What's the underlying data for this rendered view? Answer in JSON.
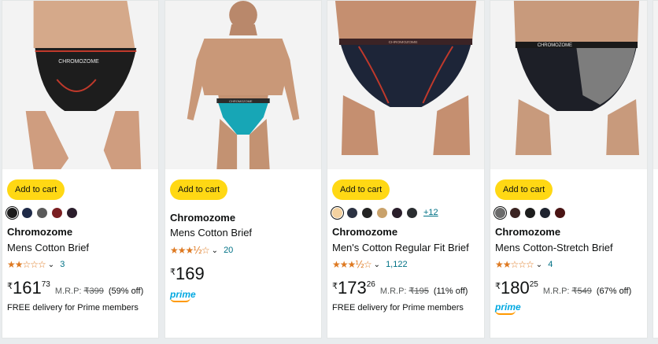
{
  "cards": [
    {
      "add_to_cart": "Add to cart",
      "swatch_colors": [
        "#1c1c1c",
        "#1f2a48",
        "#5a5a5a",
        "#7a1f22",
        "#2b1d2c"
      ],
      "more_colors": "",
      "brand": "Chromozome",
      "title": "Mens Cotton Brief",
      "stars": "★★☆☆☆",
      "rating_count": "3",
      "price": {
        "currency": "₹",
        "whole": "161",
        "fraction": "73"
      },
      "mrp_label": "M.R.P:",
      "mrp": "₹399",
      "discount": "(59% off)",
      "delivery": "FREE delivery for Prime members",
      "prime": ""
    },
    {
      "add_to_cart": "Add to cart",
      "swatch_colors": [],
      "more_colors": "",
      "brand": "Chromozome",
      "title": "Mens Cotton Brief",
      "stars": "★★★½☆",
      "rating_count": "20",
      "price": {
        "currency": "₹",
        "whole": "169",
        "fraction": ""
      },
      "mrp_label": "",
      "mrp": "",
      "discount": "",
      "delivery": "",
      "prime": "prime"
    },
    {
      "add_to_cart": "Add to cart",
      "swatch_colors": [
        "#f3d1a0",
        "#2b3242",
        "#232323",
        "#c9a26b",
        "#2a1f2b",
        "#2a2d30"
      ],
      "more_colors": "+12",
      "brand": "Chromozome",
      "title": "Men's Cotton Regular Fit Brief",
      "stars": "★★★½☆",
      "rating_count": "1,122",
      "price": {
        "currency": "₹",
        "whole": "173",
        "fraction": "26"
      },
      "mrp_label": "M.R.P:",
      "mrp": "₹195",
      "discount": "(11% off)",
      "delivery": "FREE delivery for Prime members",
      "prime": ""
    },
    {
      "add_to_cart": "Add to cart",
      "swatch_colors": [
        "#6b6b6b",
        "#3b2422",
        "#1d1d1d",
        "#1f2430",
        "#4a1414"
      ],
      "more_colors": "",
      "brand": "Chromozome",
      "title": "Mens Cotton-Stretch Brief",
      "stars": "★★☆☆☆",
      "rating_count": "4",
      "price": {
        "currency": "₹",
        "whole": "180",
        "fraction": "25"
      },
      "mrp_label": "M.R.P:",
      "mrp": "₹549",
      "discount": "(67% off)",
      "delivery": "",
      "prime": "prime"
    }
  ],
  "brand_print": [
    "CHROMOZOME",
    "CHROMOZOME",
    "CHROMOZOME",
    "CHROMOZOME"
  ],
  "colors": {
    "add_to_cart_bg": "#ffd814",
    "link": "#007185",
    "star": "#de7921",
    "prime_blue": "#00a8e1",
    "prime_orange": "#ff9900"
  }
}
